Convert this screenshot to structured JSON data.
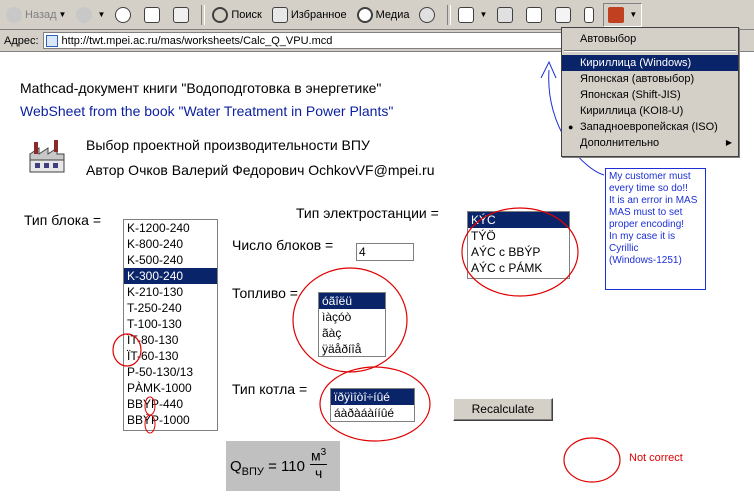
{
  "toolbar": {
    "back": "Назад",
    "search": "Поиск",
    "favorites": "Избранное",
    "media": "Медиа"
  },
  "address": {
    "label": "Адрес:",
    "url": "http://twt.mpei.ac.ru/mas/worksheets/Calc_Q_VPU.mcd"
  },
  "encoding_menu": {
    "items": [
      {
        "label": "Автовыбор",
        "selected": false,
        "checked": false,
        "submenu": false
      },
      {
        "label": "Кириллица (Windows)",
        "selected": true,
        "checked": false,
        "submenu": false
      },
      {
        "label": "Японская (автовыбор)",
        "selected": false,
        "checked": false,
        "submenu": false
      },
      {
        "label": "Японская (Shift-JIS)",
        "selected": false,
        "checked": false,
        "submenu": false
      },
      {
        "label": "Кириллица (KOI8-U)",
        "selected": false,
        "checked": false,
        "submenu": false
      },
      {
        "label": "Западноевропейская (ISO)",
        "selected": false,
        "checked": true,
        "submenu": false
      },
      {
        "label": "Дополнительно",
        "selected": false,
        "checked": false,
        "submenu": true
      }
    ]
  },
  "page": {
    "title_ru": "Mathcad-документ книги \"Водоподготовка в энергетике\"",
    "title_en": "WebSheet from the book \"Water Treatment in Power Plants\"",
    "project": "Выбор проектной производительности ВПУ",
    "author": "Автор Очков Валерий Федорович  OchkovVF@mpei.ru"
  },
  "form": {
    "block_label": "Тип блока  =",
    "block_options": [
      "K-1200-240",
      "K-800-240",
      "K-500-240",
      "K-300-240",
      "K-210-130",
      "T-250-240",
      "T-100-130",
      "ÏT-80-130",
      "ÏT-60-130",
      "P-50-130/13",
      "PÀMK-1000",
      "BBÝP-440",
      "BBÝP-1000"
    ],
    "block_selected": 3,
    "station_label": "Тип электростанции  =",
    "station_options": [
      "KÝC",
      "TÝÖ",
      "AÝC c BBÝP",
      "AÝC c PÁMK"
    ],
    "station_selected": 0,
    "count_label": "Число блоков  =",
    "count_value": "4",
    "fuel_label": "Топливо =",
    "fuel_options": [
      "óãîëü",
      "ìàçóò",
      "ãàç",
      "ÿäåðíîå"
    ],
    "fuel_selected": 0,
    "boiler_label": "Тип котла  =",
    "boiler_options": [
      "ïðÿìîòî÷íûé",
      "áàðàáàííûé"
    ],
    "boiler_selected": 0,
    "recalc_label": "Recalculate"
  },
  "result": {
    "q": "Q",
    "q_sub": "ВПУ",
    "equals_value": "= 110",
    "unit_num": "м",
    "unit_exp": "3",
    "unit_den": "ч"
  },
  "annotation": {
    "note_lines": [
      "My customer must",
      "every time so do!!",
      "It is an error in MAS",
      "MAS must to set",
      "proper encoding!",
      "In my case it is",
      "Cyrillic",
      "(Windows-1251)"
    ],
    "not_correct": "Not correct",
    "note_color": "#1c2fd6",
    "ink_color": "#e00000"
  }
}
